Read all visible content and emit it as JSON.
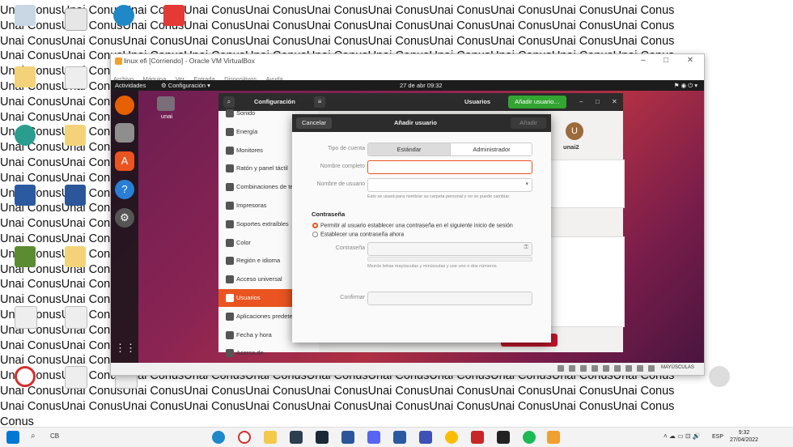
{
  "wallpaper": {
    "lines": [
      "Unai ConusUnai ConusUnai ConusUnai ConusUnai ConusUnai ConusUnai ConusUnai ConusUnai ConusUnai ConusUnai Conus",
      "Unai ConusUnai ConusUnai ConusUnai ConusUnai ConusUnai ConusUnai ConusUnai ConusUnai ConusUnai ConusUnai Conus",
      "Unai ConusUnai ConusUnai ConusUnai ConusUnai ConusUnai ConusUnai ConusUnai ConusUnai ConusUnai ConusUnai Conus",
      "Unai ConusUnai ConusUnai ConusUnai ConusUnai ConusUnai ConusUnai ConusUnai ConusUnai ConusUnai ConusUnai Conus",
      "Unai ConusUnai ConusUnai ConusUnai ConusUnai ConusUnai ConusUnai ConusUnai ConusUnai ConusUnai ConusUnai Conus",
      "Unai ConusUnai ConusUnai ConusUnai ConusUnai ConusUnai ConusUnai ConusUnai ConusUnai ConusUnai ConusUnai Conus",
      "Unai ConusUnai ConusUnai ConusUnai ConusUnai ConusUnai ConusUnai ConusUnai ConusUnai ConusUnai ConusUnai Conus",
      "Unai ConusUnai ConusUnai ConusUnai ConusUnai ConusUnai ConusUnai ConusUnai ConusUnai ConusUnai ConusUnai Conus",
      "Unai ConusUnai ConusUnai ConusUnai ConusUnai ConusUnai ConusUnai ConusUnai ConusUnai ConusUnai ConusUnai Conus",
      "Unai ConusUnai ConusUnai ConusUnai ConusUnai ConusUnai ConusUnai ConusUnai ConusUnai ConusUnai ConusUnai Conus",
      "Unai ConusUnai ConusUnai ConusUnai ConusUnai ConusUnai ConusUnai ConusUnai ConusUnai ConusUnai ConusUnai Conus",
      "Unai ConusUnai ConusUnai ConusUnai ConusUnai ConusUnai ConusUnai ConusUnai ConusUnai ConusUnai ConusUnai Conus",
      "Unai ConusUnai ConusUnai ConusUnai ConusUnai ConusUnai ConusUnai ConusUnai ConusUnai ConusUnai ConusUnai Conus",
      "Unai ConusUnai ConusUnai ConusUnai ConusUnai ConusUnai ConusUnai ConusUnai ConusUnai ConusUnai ConusUnai Conus",
      "Unai ConusUnai ConusUnai ConusUnai ConusUnai ConusUnai ConusUnai ConusUnai ConusUnai ConusUnai ConusUnai Conus",
      "Unai ConusUnai ConusUnai ConusUnai ConusUnai ConusUnai ConusUnai ConusUnai ConusUnai ConusUnai ConusUnai Conus",
      "Unai ConusUnai ConusUnai ConusUnai ConusUnai ConusUnai ConusUnai ConusUnai ConusUnai ConusUnai ConusUnai Conus",
      "Unai ConusUnai ConusUnai ConusUnai ConusUnai ConusUnai ConusUnai ConusUnai ConusUnai ConusUnai ConusUnai Conus",
      "Unai ConusUnai ConusUnai ConusUnai ConusUnai ConusUnai ConusUnai ConusUnai ConusUnai ConusUnai ConusUnai Conus",
      "Unai ConusUnai ConusUnai ConusUnai ConusUnai ConusUnai ConusUnai ConusUnai ConusUnai ConusUnai ConusUnai Conus",
      "Unai ConusUnai ConusUnai ConusUnai ConusUnai ConusUnai ConusUnai ConusUnai ConusUnai ConusUnai ConusUnai Conus",
      "Unai ConusUnai ConusUnai ConusUnai ConusUnai ConusUnai ConusUnai ConusUnai ConusUnai ConusUnai ConusUnai Conus",
      "Unai ConusUnai ConusUnai ConusUnai ConusUnai ConusUnai ConusUnai ConusUnai ConusUnai ConusUnai ConusUnai Conus",
      "Unai ConusUnai ConusUnai ConusUnai ConusUnai ConusUnai ConusUnai ConusUnai ConusUnai ConusUnai ConusUnai Conus",
      "Unai ConusUnai ConusUnai ConusUnai ConusUnai ConusUnai ConusUnai ConusUnai ConusUnai ConusUnai ConusUnai Conus",
      "Unai ConusUnai ConusUnai ConusUnai ConusUnai ConusUnai ConusUnai ConusUnai ConusUnai ConusUnai ConusUnai Conus",
      "Unai ConusUnai ConusUnai ConusUnai ConusUnai ConusUnai ConusUnai ConusUnai ConusUnai ConusUnai ConusUnai Conus",
      "Conus"
    ]
  },
  "vbox": {
    "title": "linux efi [Corriendo] - Oracle VM VirtualBox",
    "menu": [
      "Archivo",
      "Máquina",
      "Ver",
      "Entrada",
      "Dispositivos",
      "Ayuda"
    ],
    "status_caps": "MAYÚSCULAS"
  },
  "ubuntu": {
    "activities": "Actividades",
    "app_menu": "⚙ Configuración ▾",
    "clock": "27 de abr  09:32",
    "home_folder": "unai"
  },
  "settings": {
    "title": "Configuración",
    "users_title": "Usuarios",
    "add_user": "Añadir usuario…",
    "sidebar": [
      "Sonido",
      "Energía",
      "Monitores",
      "Ratón y panel táctil",
      "Combinaciones de teclado",
      "Impresoras",
      "Soportes extraíbles",
      "Color",
      "Región e idioma",
      "Acceso universal",
      "Usuarios",
      "Aplicaciones predeterminadas",
      "Fecha y hora",
      "Acerca de"
    ],
    "selected": "Usuarios",
    "avatar_letter": "U",
    "avatar_name": "unai2"
  },
  "dialog": {
    "cancel": "Cancelar",
    "title": "Añadir usuario",
    "add": "Añadir",
    "account_type_label": "Tipo de cuenta",
    "account_standard": "Estándar",
    "account_admin": "Administrador",
    "fullname_label": "Nombre completo",
    "username_label": "Nombre de usuario",
    "username_hint": "Esto se usará para nombrar su carpeta personal y no se puede cambiar.",
    "password_section": "Contraseña",
    "radio_later": "Permitir al usuario establecer una contraseña en el siguiente inicio de sesión",
    "radio_now": "Establecer una contraseña ahora",
    "password_label": "Contraseña",
    "password_hint": "Mezcle letras mayúsculas y minúsculas y use uno o dos números.",
    "confirm_label": "Confirmar"
  },
  "taskbar": {
    "search": "CB",
    "lang": "ESP",
    "time": "9:32",
    "date": "27/04/2022"
  }
}
